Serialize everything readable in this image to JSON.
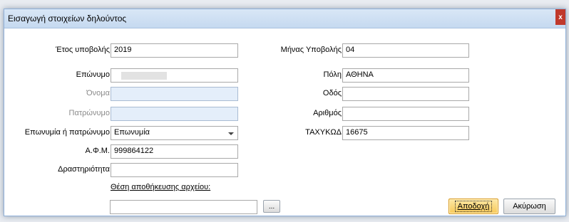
{
  "dialog": {
    "title": "Εισαγωγή στοιχείων δηλούντος",
    "close_label": "x"
  },
  "form": {
    "year_label": "Έτος υποβολής",
    "year_value": "2019",
    "month_label": "Μήνας Υποβολής",
    "month_value": "04",
    "surname_label": "Επώνυμο",
    "surname_value": "",
    "name_label": "Όνομα",
    "name_value": "",
    "fathername_label": "Πατρώνυμο",
    "fathername_value": "",
    "nametype_label": "Επωνυμία ή πατρώνυμο",
    "nametype_value": "Επωνυμία",
    "afm_label": "Α.Φ.Μ.",
    "afm_value": "999864122",
    "activity_label": "Δραστηριότητα",
    "activity_value": "",
    "city_label": "Πόλη",
    "city_value": "ΑΘΗΝΑ",
    "street_label": "Οδός",
    "street_value": "",
    "number_label": "Αριθμός",
    "number_value": "",
    "zip_label": "ΤΑΧΥΚΩΔ",
    "zip_value": "16675",
    "save_location_label": "Θέση αποθήκευσης αρχείου:",
    "save_location_value": ""
  },
  "buttons": {
    "browse": "...",
    "accept": "Αποδοχή",
    "cancel": "Ακύρωση"
  },
  "colors": {
    "titlebar": "#c5d9f0",
    "close": "#c0392b",
    "primary_button": "#f7c957",
    "disabled_field": "#e4eefa"
  },
  "icons": {
    "close": "close-icon",
    "dropdown": "chevron-down-icon"
  }
}
